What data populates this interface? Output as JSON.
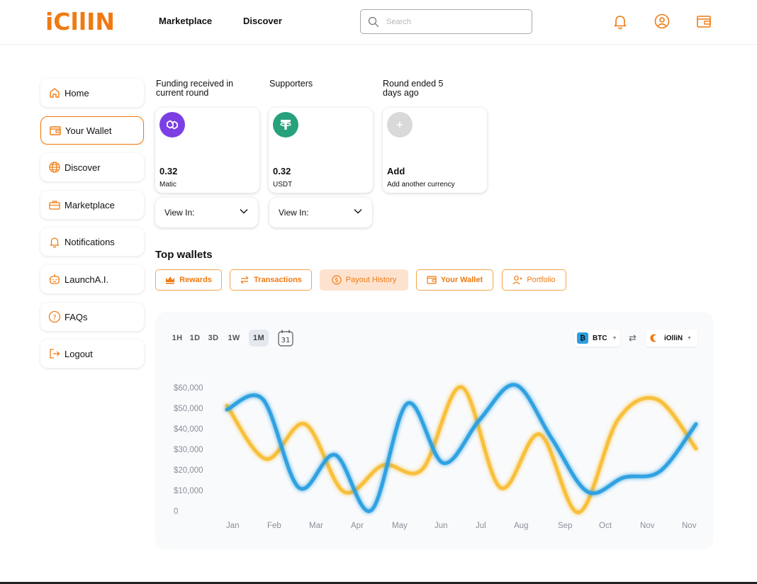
{
  "brand": {
    "name": "iCllIN",
    "accent": "#f07a12"
  },
  "nav": {
    "marketplace": "Marketplace",
    "discover": "Discover"
  },
  "search": {
    "placeholder": "Search"
  },
  "header_icons": [
    "bell-icon",
    "user-circle-icon",
    "wallet-icon"
  ],
  "sidebar": {
    "items": [
      {
        "label": "Home",
        "icon": "home-icon",
        "active": false
      },
      {
        "label": "Your Wallet",
        "icon": "wallet-icon",
        "active": true
      },
      {
        "label": "Discover",
        "icon": "globe-icon",
        "active": false
      },
      {
        "label": "Marketplace",
        "icon": "briefcase-icon",
        "active": false
      },
      {
        "label": "Notifications",
        "icon": "bell-icon",
        "active": false
      },
      {
        "label": "LaunchA.I.",
        "icon": "robot-icon",
        "active": false
      },
      {
        "label": "FAQs",
        "icon": "question-icon",
        "active": false
      },
      {
        "label": "Logout",
        "icon": "logout-icon",
        "active": false
      }
    ]
  },
  "funding": {
    "received_label": "Funding received in current round",
    "supporters_label": "Supporters",
    "round_label": "Round ended 5 days ago",
    "cards": [
      {
        "amount": "0.32",
        "currency": "Matic",
        "icon": "polygon-icon",
        "color": "#7b3fe4"
      },
      {
        "amount": "0.32",
        "currency": "USDT",
        "icon": "tether-icon",
        "color": "#26a17b"
      },
      {
        "amount": "Add",
        "currency": "Add another currency",
        "icon": "plus-icon",
        "color": "#d4d4d4"
      }
    ],
    "view_in_label": "View In:"
  },
  "top_wallets": {
    "title": "Top wallets",
    "tabs": [
      {
        "label": "Rewards",
        "icon": "crown-icon",
        "active": false
      },
      {
        "label": "Transactions",
        "icon": "swap-icon",
        "active": false
      },
      {
        "label": "Payout History",
        "icon": "dollar-circle-icon",
        "active": true
      },
      {
        "label": "Your Wallet",
        "icon": "wallet-icon",
        "active": false
      },
      {
        "label": "Portfolio",
        "icon": "user-plus-icon",
        "active": false
      }
    ]
  },
  "chart_controls": {
    "ranges": [
      "1H",
      "1D",
      "3D",
      "1W",
      "1M"
    ],
    "active_range": "1M",
    "calendar_day": "31",
    "from_token": "BTC",
    "to_token": "iOlliN",
    "colors": {
      "btc": "#2b9fe0",
      "iollin": "#f8bb2a"
    }
  },
  "chart_data": {
    "type": "line",
    "categories": [
      "Jan",
      "Feb",
      "Mar",
      "Apr",
      "May",
      "Jun",
      "Jul",
      "Aug",
      "Sep",
      "Oct",
      "Nov",
      "Nov"
    ],
    "ylim": [
      0,
      60000
    ],
    "ytick_labels": [
      "$60,000",
      "$50,000",
      "$40,000",
      "$30,000",
      "$20,000",
      "$10,000",
      "0"
    ],
    "series": [
      {
        "values": [
          50000,
          55000,
          12000,
          28000,
          1000,
          53000,
          24000,
          45000,
          62000,
          36000,
          10000,
          17000,
          20000,
          43000
        ]
      },
      {
        "values": [
          52000,
          26000,
          43000,
          10000,
          23000,
          21000,
          61000,
          12000,
          38000,
          0,
          45000,
          55000,
          31000
        ]
      }
    ]
  }
}
